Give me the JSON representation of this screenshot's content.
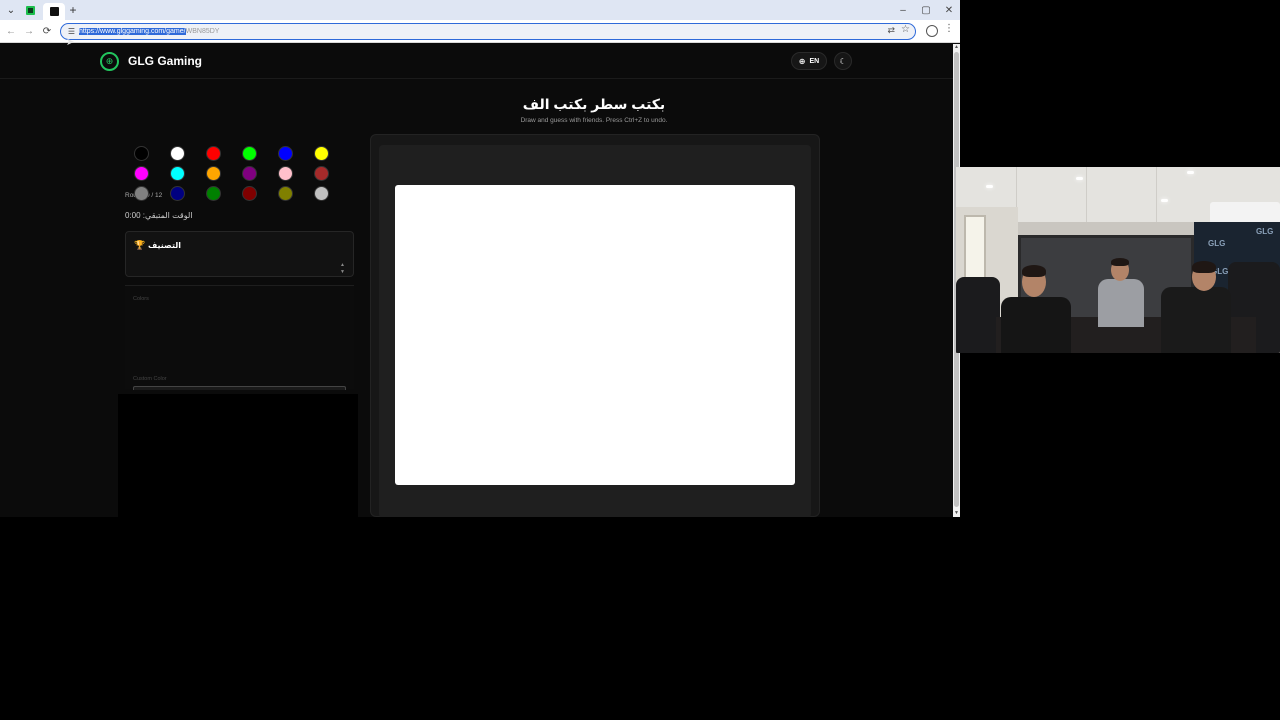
{
  "browser": {
    "tabs": [
      {
        "name": "glg-favicon-tab"
      },
      {
        "name": "active-tab"
      }
    ],
    "new_tab_label": "+",
    "window_controls": {
      "minimize": "–",
      "maximize": "▢",
      "close": "✕"
    },
    "nav": {
      "back": "←",
      "forward": "→",
      "reload": "⟳"
    },
    "url_selected": "https://www.glggaming.com/game/",
    "url_rest": "WBN85DY",
    "omnibox_icons": {
      "site_info": "☰",
      "translate": "⇄",
      "bookmark": "☆"
    },
    "toolbar_icons": {
      "profile": "●",
      "menu": "⋮"
    }
  },
  "site": {
    "logo_icon": "gamepad-icon",
    "logo_glyph": "⊕",
    "brand_name": "GLG Gaming",
    "brand_color": "#22c55e",
    "language_button": "EN",
    "globe_glyph": "⊕",
    "theme_glyph": "☾"
  },
  "game": {
    "title": "بكتب سطر بكتب الف",
    "subtitle": "Draw and guess with friends. Press Ctrl+Z to undo.",
    "round": "Round 0 / 12",
    "timer": "الوقت المتبقي: 0:00",
    "ranking_title": "التصنيف",
    "trophy_glyph": "🏆",
    "colors_label": "Colors",
    "custom_color_label": "Custom Color",
    "palette": [
      "#000000",
      "#ffffff",
      "#ff0000",
      "#00ff00",
      "#0000ff",
      "#ffff00",
      "#ff00ff",
      "#00ffff",
      "#ffa500",
      "#800080",
      "#ffc0cb",
      "#a52a2a",
      "#808080",
      "#000080",
      "#008000",
      "#800000",
      "#808000",
      "#c0c0c0"
    ],
    "canvas_background": "#ffffff"
  },
  "overlay": {
    "webcam": "webcam-feed",
    "decal_text": "GLG"
  }
}
